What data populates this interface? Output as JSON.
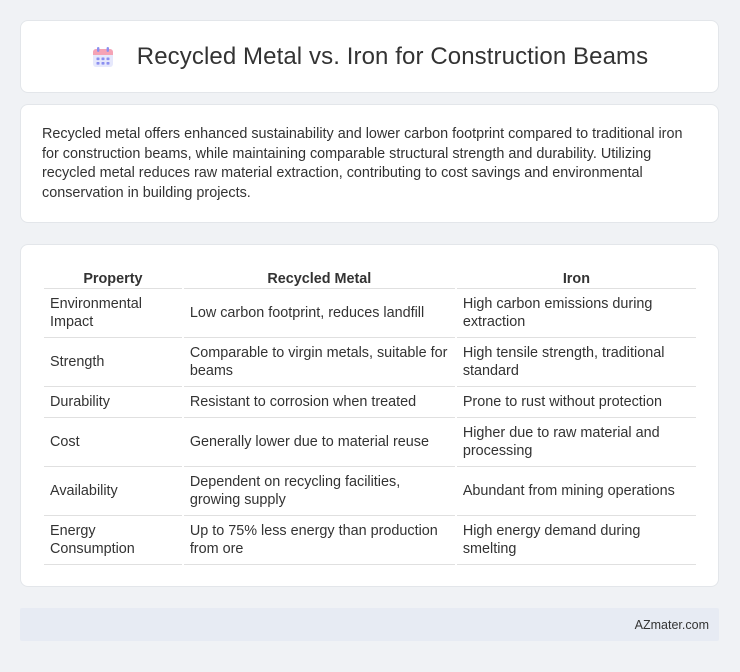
{
  "header": {
    "title": "Recycled Metal vs. Iron for Construction Beams",
    "icon": "calendar-icon"
  },
  "summary": {
    "text": "Recycled metal offers enhanced sustainability and lower carbon footprint compared to traditional iron for construction beams, while maintaining comparable structural strength and durability. Utilizing recycled metal reduces raw material extraction, contributing to cost savings and environmental conservation in building projects."
  },
  "table": {
    "headers": [
      "Property",
      "Recycled Metal",
      "Iron"
    ],
    "rows": [
      [
        "Environmental Impact",
        "Low carbon footprint, reduces landfill",
        "High carbon emissions during extraction"
      ],
      [
        "Strength",
        "Comparable to virgin metals, suitable for beams",
        "High tensile strength, traditional standard"
      ],
      [
        "Durability",
        "Resistant to corrosion when treated",
        "Prone to rust without protection"
      ],
      [
        "Cost",
        "Generally lower due to material reuse",
        "Higher due to raw material and processing"
      ],
      [
        "Availability",
        "Dependent on recycling facilities, growing supply",
        "Abundant from mining operations"
      ],
      [
        "Energy Consumption",
        "Up to 75% less energy than production from ore",
        "High energy demand during smelting"
      ]
    ]
  },
  "footer": {
    "brand": "AZmater.com"
  },
  "colors": {
    "background": "#f0f2f5",
    "card": "#ffffff",
    "footer": "#e7ebf3",
    "icon_primary": "#8b8ff0",
    "icon_accent": "#f5a3b5"
  }
}
